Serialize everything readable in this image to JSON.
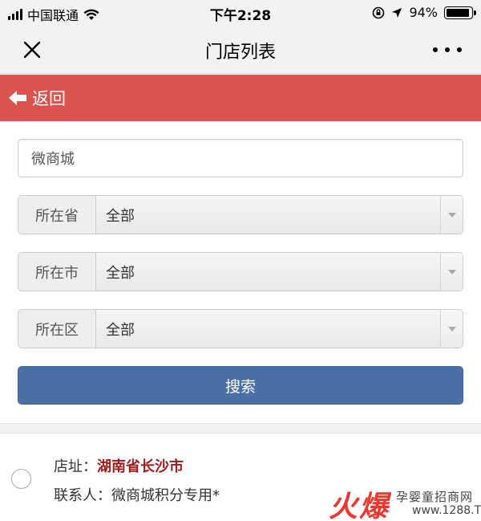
{
  "status_bar": {
    "carrier": "中国联通",
    "time": "下午2:28",
    "battery": "94%",
    "battery_level": 0.94
  },
  "nav": {
    "title": "门店列表",
    "close_icon": "close-icon",
    "more_icon": "more-icon"
  },
  "back_bar": {
    "label": "返回",
    "icon": "arrow-left-icon",
    "color": "#d9534f"
  },
  "search": {
    "value": "微商城"
  },
  "filters": [
    {
      "label": "所在省",
      "selected": "全部"
    },
    {
      "label": "所在市",
      "selected": "全部"
    },
    {
      "label": "所在区",
      "selected": "全部"
    }
  ],
  "search_button": {
    "label": "搜索",
    "color": "#4a6fa5"
  },
  "store": {
    "address_label": "店址：",
    "address": "湖南省长沙市",
    "contact_label": "联系人：",
    "contact": "微商城积分专用*"
  },
  "watermark": {
    "big": "火爆",
    "top": "孕婴童招商网",
    "bottom": "www.1288.TV"
  }
}
